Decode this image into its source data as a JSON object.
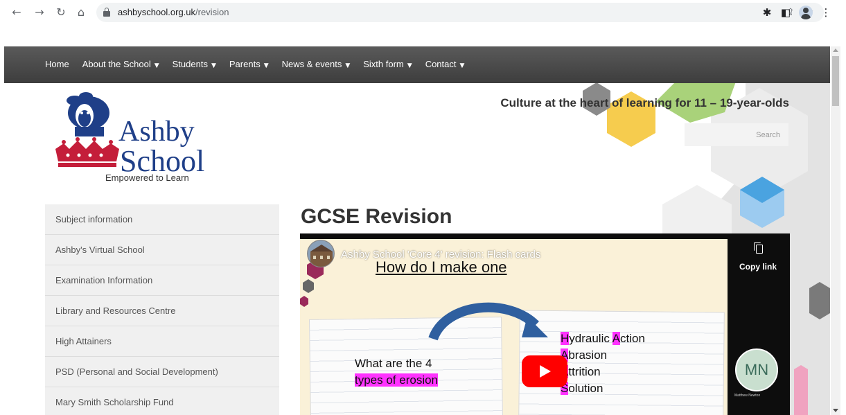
{
  "browser": {
    "url_domain": "ashbyschool.org.uk",
    "url_path": "/revision",
    "icons": [
      "back-icon",
      "forward-icon",
      "reload-icon",
      "home-icon",
      "lock-icon",
      "share-icon",
      "bookmark-star-icon",
      "extensions-icon",
      "side-panel-icon",
      "profile-icon",
      "menu-icon"
    ],
    "glyphs": {
      "back": "←",
      "forward": "→",
      "reload": "↻",
      "home": "⌂",
      "share": "⇪",
      "star": "☆",
      "extensions": "✱",
      "sidepanel": "◧",
      "menu": "⋮"
    }
  },
  "nav": {
    "items": [
      {
        "label": "Home",
        "caret": ""
      },
      {
        "label": "About the School",
        "caret": "▼"
      },
      {
        "label": "Students",
        "caret": "▼"
      },
      {
        "label": "Parents",
        "caret": "▼"
      },
      {
        "label": "News & events",
        "caret": "▼"
      },
      {
        "label": "Sixth form",
        "caret": "▼"
      },
      {
        "label": "Contact",
        "caret": "▼"
      }
    ]
  },
  "header": {
    "logo_line1": "Ashby",
    "logo_line2": "School",
    "logo_tagline": "Empowered to Learn",
    "tagline": "Culture at the heart of learning for 11 – 19-year-olds",
    "search_placeholder": "Search"
  },
  "sidebar": {
    "items": [
      {
        "label": "Subject information"
      },
      {
        "label": "Ashby's Virtual School"
      },
      {
        "label": "Examination Information"
      },
      {
        "label": "Library and Resources Centre"
      },
      {
        "label": "High Attainers"
      },
      {
        "label": "PSD (Personal and Social Development)"
      },
      {
        "label": "Mary Smith Scholarship Fund"
      }
    ]
  },
  "main": {
    "title": "GCSE Revision"
  },
  "video": {
    "title": "Ashby School 'Core 4' revision: Flash cards",
    "copy_label": "Copy link",
    "slide_title": "How do I make one",
    "question_line1": "What are the 4",
    "question_line2": "types of erosion",
    "answers": [
      {
        "first": "H",
        "rest": "ydraulic ",
        "second": "A",
        "rest2": "ction"
      },
      {
        "first": "A",
        "rest": "brasion",
        "second": "",
        "rest2": ""
      },
      {
        "first": "A",
        "rest": "ttrition",
        "second": "",
        "rest2": ""
      },
      {
        "first": "S",
        "rest": "olution",
        "second": "",
        "rest2": ""
      }
    ],
    "badge_initials": "MN",
    "badge_name": "Matthew Newton"
  },
  "colors": {
    "brand_blue": "#1f3f88",
    "brand_red": "#c41e3a",
    "highlight_magenta": "#ff33ff",
    "nav_bg": "#4a4a4a",
    "youtube_red": "#ff0000"
  }
}
